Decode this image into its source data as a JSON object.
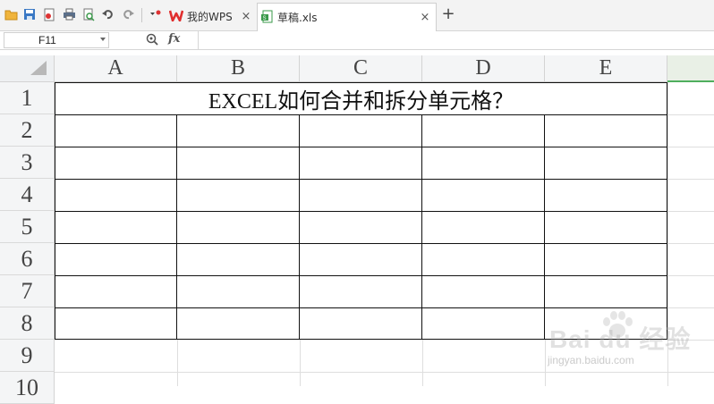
{
  "toolbar": {
    "icons": [
      "open-folder-icon",
      "save-icon",
      "pdf-export-icon",
      "print-icon",
      "print-preview-icon",
      "undo-icon",
      "redo-icon",
      "customize-icon"
    ]
  },
  "tabs": [
    {
      "label": "我的WPS",
      "icon": "wps-logo-icon",
      "close": "×"
    },
    {
      "label": "草稿.xls",
      "icon": "spreadsheet-icon",
      "close": "×"
    }
  ],
  "new_tab_label": "+",
  "formula_bar": {
    "cell_ref": "F11",
    "fx_label": "fx",
    "formula_value": ""
  },
  "sheet": {
    "columns": [
      "A",
      "B",
      "C",
      "D",
      "E"
    ],
    "rows": [
      "1",
      "2",
      "3",
      "4",
      "5",
      "6",
      "7",
      "8",
      "9",
      "10"
    ],
    "merged_title": "EXCEL如何合并和拆分单元格？"
  },
  "watermark": {
    "main": "Bai du 经验",
    "sub": "jingyan.baidu.com"
  },
  "colors": {
    "selection_accent": "#4fae5e",
    "header_bg": "#f4f5f6",
    "wps_red": "#e02f2f"
  }
}
